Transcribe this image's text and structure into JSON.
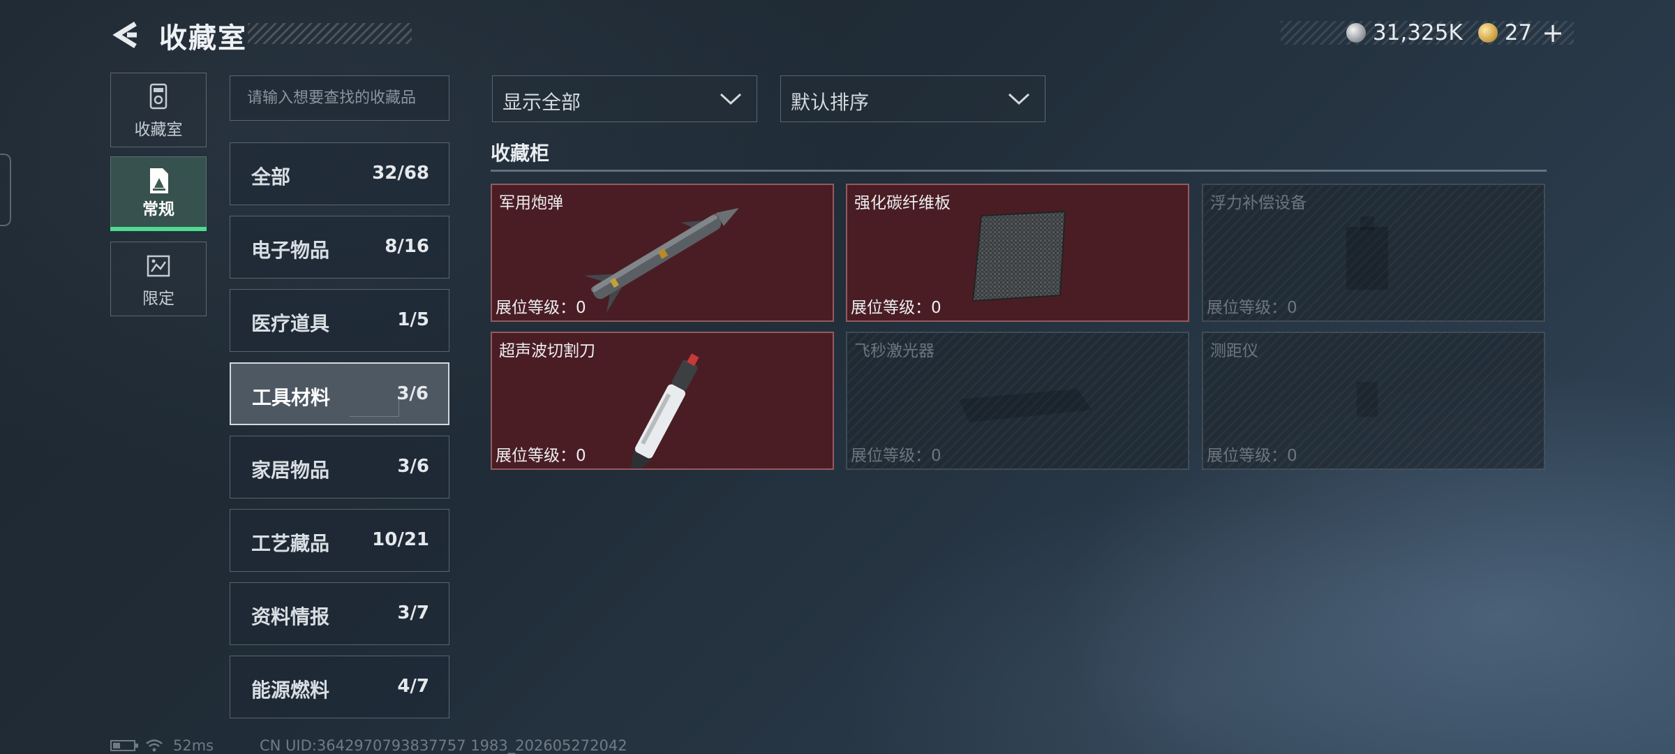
{
  "header": {
    "title": "收藏室"
  },
  "currency": {
    "silver": "31,325K",
    "gold": "27",
    "add_label": "+"
  },
  "rail": [
    {
      "label": "收藏室",
      "icon": "collection-icon"
    },
    {
      "label": "常规",
      "icon": "document-icon",
      "active": true
    },
    {
      "label": "限定",
      "icon": "limited-icon"
    }
  ],
  "search": {
    "placeholder": "请输入想要查找的收藏品"
  },
  "categories": [
    {
      "name": "全部",
      "count": "32/68"
    },
    {
      "name": "电子物品",
      "count": "8/16"
    },
    {
      "name": "医疗道具",
      "count": "1/5"
    },
    {
      "name": "工具材料",
      "count": "3/6",
      "active": true
    },
    {
      "name": "家居物品",
      "count": "3/6"
    },
    {
      "name": "工艺藏品",
      "count": "10/21"
    },
    {
      "name": "资料情报",
      "count": "3/7"
    },
    {
      "name": "能源燃料",
      "count": "4/7"
    }
  ],
  "filters": {
    "display": "显示全部",
    "sort": "默认排序"
  },
  "section": {
    "title": "收藏柜"
  },
  "items": [
    {
      "name": "军用炮弹",
      "level": "展位等级：0",
      "owned": true
    },
    {
      "name": "强化碳纤维板",
      "level": "展位等级：0",
      "owned": true
    },
    {
      "name": "浮力补偿设备",
      "level": "展位等级：0",
      "owned": false
    },
    {
      "name": "超声波切割刀",
      "level": "展位等级：0",
      "owned": true
    },
    {
      "name": "飞秒激光器",
      "level": "展位等级：0",
      "owned": false
    },
    {
      "name": "测距仪",
      "level": "展位等级：0",
      "owned": false
    }
  ],
  "status": {
    "ping": "52ms",
    "uid": "CN UID:3642970793837757 1983_202605272042"
  },
  "colors": {
    "accent_green": "#4fdc8f",
    "owned_card": "#4a1d24"
  }
}
